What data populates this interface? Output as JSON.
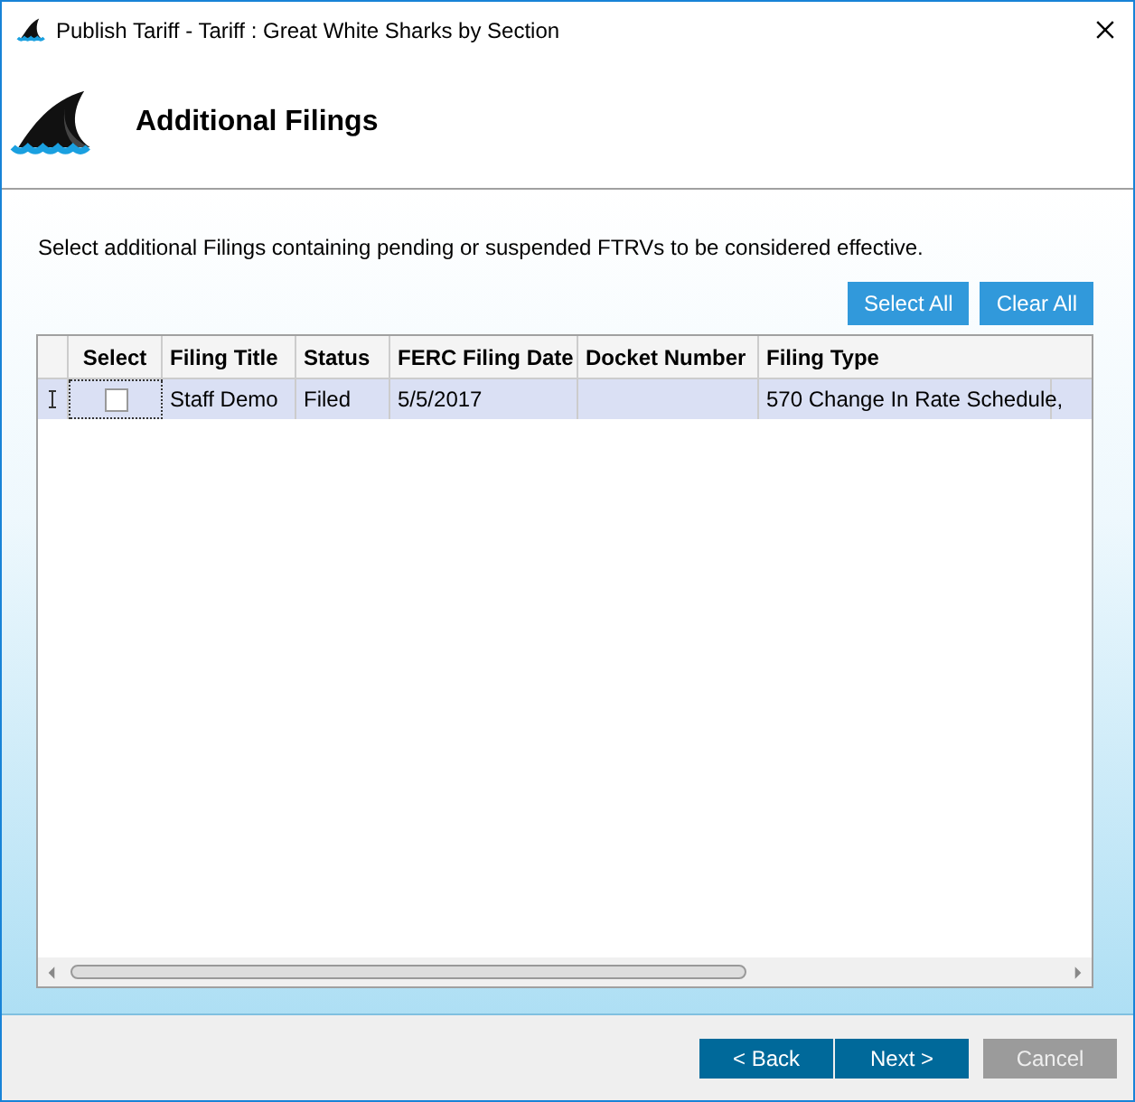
{
  "window": {
    "title": "Publish Tariff - Tariff : Great White Sharks by Section"
  },
  "header": {
    "title": "Additional Filings"
  },
  "instruction": "Select additional Filings containing pending or suspended FTRVs to be considered effective.",
  "actions": [
    "Select All",
    "Clear All"
  ],
  "table": {
    "columns": [
      "Select",
      "Filing Title",
      "Status",
      "FERC Filing Date",
      "Docket Number",
      "Filing Type"
    ],
    "rows": [
      {
        "selected": true,
        "checked": false,
        "cells": [
          "",
          "Staff Demo",
          "Filed",
          "5/5/2017",
          "",
          "570 Change In Rate Schedule,"
        ]
      }
    ]
  },
  "buttons": [
    {
      "label": "< Back",
      "disabled": false
    },
    {
      "label": "Next >",
      "disabled": false
    },
    {
      "label": "Cancel",
      "disabled": true
    }
  ]
}
